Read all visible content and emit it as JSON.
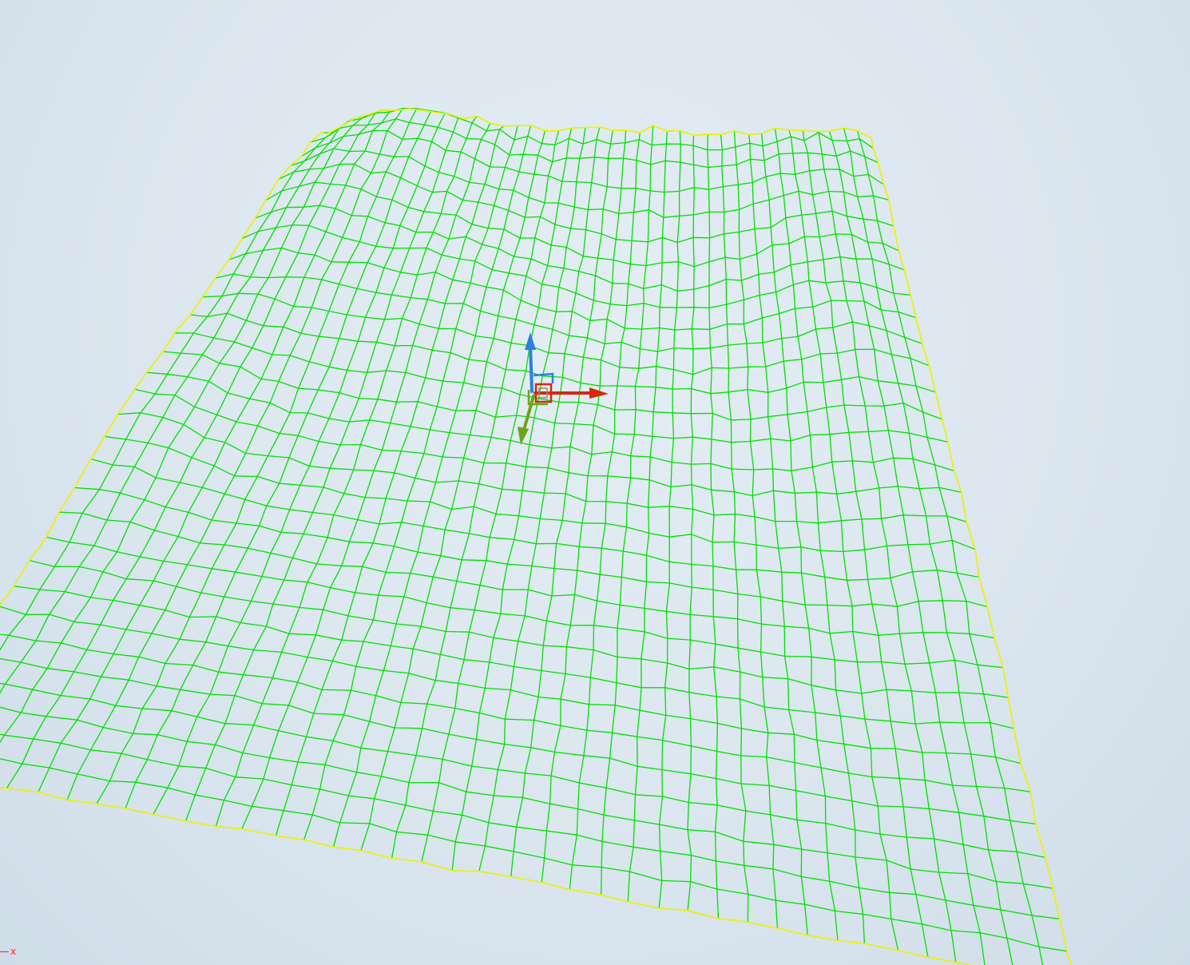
{
  "viewport": {
    "background": "#dde8f0",
    "mesh": {
      "type": "wireframe-terrain",
      "grid_columns": 40,
      "grid_rows": 32,
      "line_color": "#00e000",
      "outline_color": "#f2f200"
    },
    "gizmo": {
      "x_axis_color": "#d42a10",
      "y_axis_color": "#6aa51a",
      "z_axis_color": "#2c7fe0",
      "icon": "transform-gizmo-icon"
    }
  },
  "axis_indicator": {
    "label": "x",
    "color": "#ff2020"
  }
}
